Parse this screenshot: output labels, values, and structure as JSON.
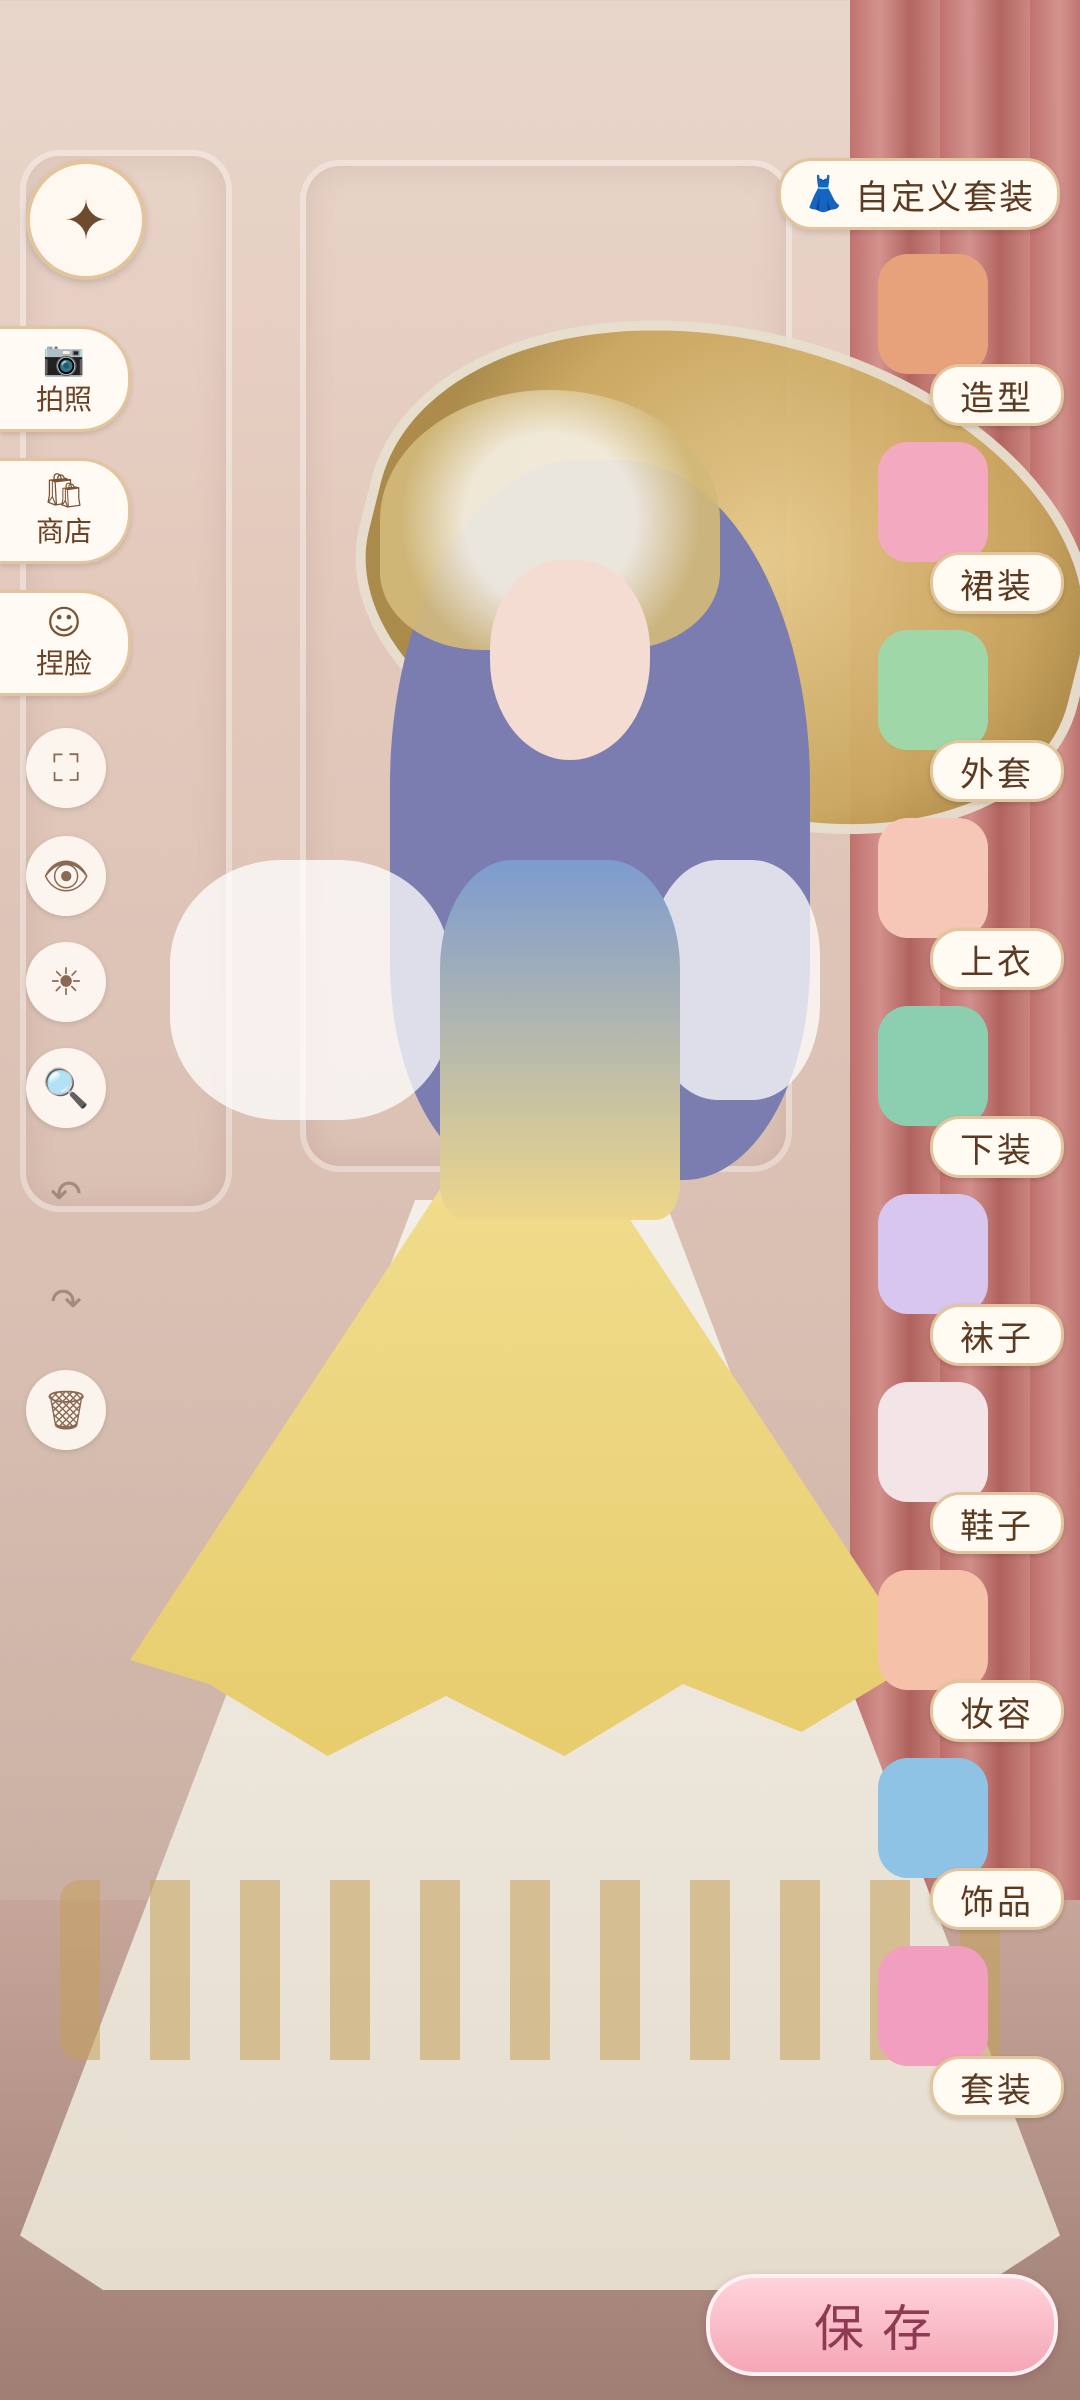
{
  "left_menu": {
    "back_icon": "compass-star-icon",
    "buttons": [
      {
        "id": "photo",
        "label": "拍照",
        "icon": "camera-icon",
        "glyph": "📷"
      },
      {
        "id": "shop",
        "label": "商店",
        "icon": "shop-bag-icon",
        "glyph": "🛍"
      },
      {
        "id": "face",
        "label": "捏脸",
        "icon": "face-icon",
        "glyph": "☺"
      }
    ],
    "tools": [
      {
        "id": "fullscreen",
        "icon": "fullscreen-icon",
        "glyph": "⛶"
      },
      {
        "id": "view",
        "icon": "eye-icon",
        "glyph": "👁"
      },
      {
        "id": "lighting",
        "icon": "sun-icon",
        "glyph": "☀"
      },
      {
        "id": "zoom",
        "icon": "magnifier-icon",
        "glyph": "🔍"
      },
      {
        "id": "undo",
        "icon": "undo-icon",
        "glyph": "↶"
      },
      {
        "id": "redo",
        "icon": "redo-icon",
        "glyph": "↷"
      },
      {
        "id": "delete",
        "icon": "trash-icon",
        "glyph": "🗑"
      }
    ]
  },
  "custom_outfit": {
    "label": "自定义套装",
    "icon": "dress-icon",
    "glyph": "👗"
  },
  "categories": [
    {
      "id": "styling",
      "label": "造型",
      "thumb_color": "#e7a27b"
    },
    {
      "id": "dress",
      "label": "裙装",
      "thumb_color": "#f3a9c0"
    },
    {
      "id": "coat",
      "label": "外套",
      "thumb_color": "#9fd7a8"
    },
    {
      "id": "top",
      "label": "上衣",
      "thumb_color": "#f6c7b6"
    },
    {
      "id": "bottom",
      "label": "下装",
      "thumb_color": "#8ccfb0"
    },
    {
      "id": "socks",
      "label": "袜子",
      "thumb_color": "#d9c6ee"
    },
    {
      "id": "shoes",
      "label": "鞋子",
      "thumb_color": "#f3e4e8"
    },
    {
      "id": "makeup",
      "label": "妆容",
      "thumb_color": "#f5c1a8"
    },
    {
      "id": "accessories",
      "label": "饰品",
      "thumb_color": "#8fc3e6"
    },
    {
      "id": "sets",
      "label": "套装",
      "thumb_color": "#f29fbf"
    }
  ],
  "save": {
    "label": "保存"
  },
  "colors": {
    "accent_border": "#e2c59d",
    "button_bg": "#fffaf2",
    "text": "#5b3a22",
    "save_pink": "#f4a6b6"
  }
}
